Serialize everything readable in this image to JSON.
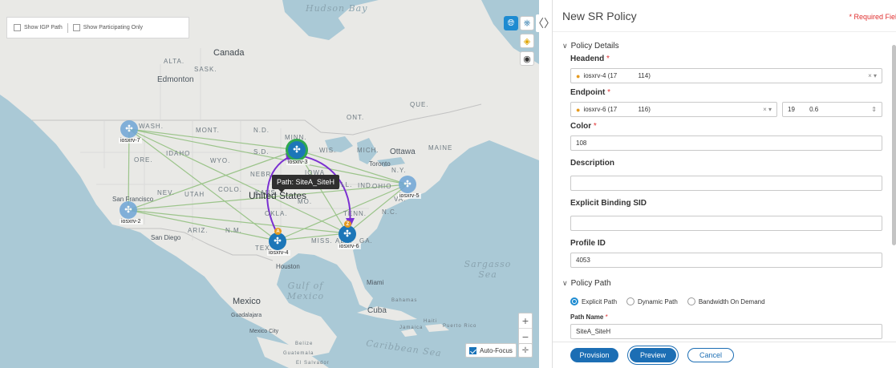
{
  "map": {
    "show_igp_label": "Show IGP Path",
    "show_participating_label": "Show Participating Only",
    "labels": {
      "hudson_bay": "Hudson Bay",
      "canada": "Canada",
      "edmonton": "Edmonton",
      "alta": "ALTA.",
      "sask": "SASK.",
      "mont": "MONT.",
      "wash": "WASH.",
      "ore": "ORE.",
      "idaho": "IDAHO",
      "wyo": "WYO.",
      "nev": "NEV.",
      "utah": "UTAH",
      "colo": "COLO.",
      "ariz": "ARIZ.",
      "nm": "N.M.",
      "nd": "N.D.",
      "sd": "S.D.",
      "nebr": "NEBR.",
      "kans": "KANS.",
      "mo": "MO.",
      "okla": "OKLA.",
      "tex": "TEX.",
      "minn": "MINN.",
      "wis": "WIS.",
      "mich": "MICH.",
      "iowa": "IOWA",
      "ill": "ILL.",
      "ohio": "OHIO",
      "ind": "IND.",
      "tenn": "TENN.",
      "miss": "MISS.",
      "ala": "ALA.",
      "ga": "GA.",
      "nc": "N.C.",
      "va": "VA.",
      "ny": "N.Y.",
      "maine": "MAINE",
      "ont": "ONT.",
      "que": "QUE.",
      "ottawa": "Ottawa",
      "toronto": "Toronto",
      "united_states": "United States",
      "san_francisco": "San Francisco",
      "san_diego": "San Diego",
      "houston": "Houston",
      "miami": "Miami",
      "mexico": "Mexico",
      "guadalajara": "Guadalajara",
      "mexico_city": "Mexico City",
      "gulf_of_mexico": "Gulf of Mexico",
      "cuba": "Cuba",
      "bahamas": "Bahamas",
      "jamaica": "Jamaica",
      "haiti": "Haiti",
      "puerto_rico": "Puerto Rico",
      "belize": "Belize",
      "guatemala": "Guatemala",
      "el_salvador": "El Salvador",
      "sargasso_sea": "Sargasso Sea",
      "caribbean_sea": "Caribbean Sea"
    },
    "nodes": [
      {
        "id": "iosxrv-7",
        "label": "iosxrv-7",
        "state": "dim"
      },
      {
        "id": "iosxrv-3",
        "label": "iosxrv-3",
        "state": "selected"
      },
      {
        "id": "iosxrv-5",
        "label": "iosxrv-5",
        "state": "dim"
      },
      {
        "id": "iosxrv-2",
        "label": "iosxrv-2",
        "state": "dim"
      },
      {
        "id": "iosxrv-4",
        "label": "iosxrv-4",
        "state": "active",
        "badge": "A"
      },
      {
        "id": "iosxrv-6",
        "label": "iosxrv-6",
        "state": "active",
        "badge": "Z"
      }
    ],
    "tooltip": "Path: SiteA_SiteH",
    "auto_focus_label": "Auto-Focus",
    "auto_focus_checked": true,
    "zoom_in": "+",
    "zoom_out": "−",
    "colors": {
      "water": "#aac9d6",
      "land": "#e9e9e6",
      "link": "#9bc48a",
      "path": "#7a2fd1",
      "selected_ring": "#2fa84f"
    }
  },
  "panel": {
    "title": "New SR Policy",
    "required_note": "* Required Fiel",
    "policy_details": "Policy Details",
    "headend": {
      "label": "Headend",
      "value": "iosxrv-4 (17    114)"
    },
    "endpoint": {
      "label": "Endpoint",
      "value": "iosxrv-6 (17    116)",
      "ip": "19   0.6"
    },
    "color": {
      "label": "Color",
      "value": "108"
    },
    "description": {
      "label": "Description",
      "value": ""
    },
    "binding_sid": {
      "label": "Explicit Binding SID",
      "value": ""
    },
    "profile_id": {
      "label": "Profile ID",
      "value": "4053"
    },
    "policy_path": "Policy Path",
    "path_options": [
      "Explicit Path",
      "Dynamic Path",
      "Bandwidth On Demand"
    ],
    "path_selected": "Explicit Path",
    "path_name": {
      "label": "Path Name",
      "value": "SiteA_SiteH"
    },
    "req_mark": "*",
    "clear_mark": "×",
    "caret": "▾"
  },
  "footer": {
    "provision": "Provision",
    "preview": "Preview",
    "cancel": "Cancel"
  }
}
